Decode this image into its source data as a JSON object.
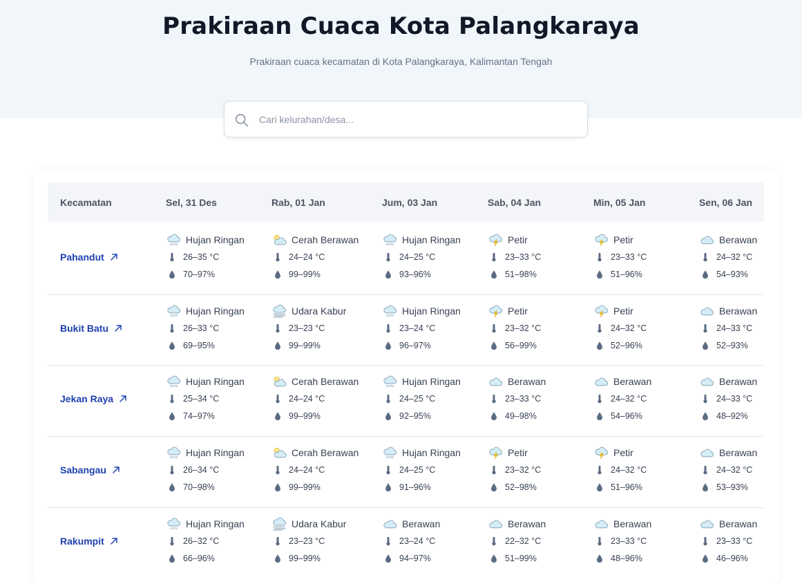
{
  "header": {
    "title": "Prakiraan Cuaca Kota Palangkaraya",
    "subtitle": "Prakiraan cuaca kecamatan di Kota Palangkaraya, Kalimantan Tengah"
  },
  "search": {
    "placeholder": "Cari kelurahan/desa..."
  },
  "table": {
    "col_header": "Kecamatan",
    "days": [
      "Sel, 31 Des",
      "Rab, 01 Jan",
      "Jum, 03 Jan",
      "Sab, 04 Jan",
      "Min, 05 Jan",
      "Sen, 06 Jan"
    ],
    "rows": [
      {
        "name": "Pahandut",
        "cells": [
          {
            "icon": "rain-cloud-icon",
            "cond": "Hujan Ringan",
            "temp": "26–35 °C",
            "hum": "70–97%"
          },
          {
            "icon": "sun-cloud-icon",
            "cond": "Cerah Berawan",
            "temp": "24–24 °C",
            "hum": "99–99%"
          },
          {
            "icon": "rain-cloud-icon",
            "cond": "Hujan Ringan",
            "temp": "24–25 °C",
            "hum": "93–96%"
          },
          {
            "icon": "thunder-cloud-icon",
            "cond": "Petir",
            "temp": "23–33 °C",
            "hum": "51–98%"
          },
          {
            "icon": "thunder-cloud-icon",
            "cond": "Petir",
            "temp": "23–33 °C",
            "hum": "51–96%"
          },
          {
            "icon": "cloud-icon",
            "cond": "Berawan",
            "temp": "24–32 °C",
            "hum": "54–93%"
          }
        ]
      },
      {
        "name": "Bukit Batu",
        "cells": [
          {
            "icon": "rain-cloud-icon",
            "cond": "Hujan Ringan",
            "temp": "26–33 °C",
            "hum": "69–95%"
          },
          {
            "icon": "haze-icon",
            "cond": "Udara Kabur",
            "temp": "23–23 °C",
            "hum": "99–99%"
          },
          {
            "icon": "rain-cloud-icon",
            "cond": "Hujan Ringan",
            "temp": "23–24 °C",
            "hum": "96–97%"
          },
          {
            "icon": "thunder-cloud-icon",
            "cond": "Petir",
            "temp": "23–32 °C",
            "hum": "56–99%"
          },
          {
            "icon": "thunder-cloud-icon",
            "cond": "Petir",
            "temp": "24–32 °C",
            "hum": "52–96%"
          },
          {
            "icon": "cloud-icon",
            "cond": "Berawan",
            "temp": "24–33 °C",
            "hum": "52–93%"
          }
        ]
      },
      {
        "name": "Jekan Raya",
        "cells": [
          {
            "icon": "rain-cloud-icon",
            "cond": "Hujan Ringan",
            "temp": "25–34 °C",
            "hum": "74–97%"
          },
          {
            "icon": "sun-cloud-icon",
            "cond": "Cerah Berawan",
            "temp": "24–24 °C",
            "hum": "99–99%"
          },
          {
            "icon": "rain-cloud-icon",
            "cond": "Hujan Ringan",
            "temp": "24–25 °C",
            "hum": "92–95%"
          },
          {
            "icon": "cloud-icon",
            "cond": "Berawan",
            "temp": "23–33 °C",
            "hum": "49–98%"
          },
          {
            "icon": "cloud-icon",
            "cond": "Berawan",
            "temp": "24–32 °C",
            "hum": "54–96%"
          },
          {
            "icon": "cloud-icon",
            "cond": "Berawan",
            "temp": "24–33 °C",
            "hum": "48–92%"
          }
        ]
      },
      {
        "name": "Sabangau",
        "cells": [
          {
            "icon": "rain-cloud-icon",
            "cond": "Hujan Ringan",
            "temp": "26–34 °C",
            "hum": "70–98%"
          },
          {
            "icon": "sun-cloud-icon",
            "cond": "Cerah Berawan",
            "temp": "24–24 °C",
            "hum": "99–99%"
          },
          {
            "icon": "rain-cloud-icon",
            "cond": "Hujan Ringan",
            "temp": "24–25 °C",
            "hum": "91–96%"
          },
          {
            "icon": "thunder-cloud-icon",
            "cond": "Petir",
            "temp": "23–32 °C",
            "hum": "52–98%"
          },
          {
            "icon": "thunder-cloud-icon",
            "cond": "Petir",
            "temp": "24–32 °C",
            "hum": "51–96%"
          },
          {
            "icon": "cloud-icon",
            "cond": "Berawan",
            "temp": "24–32 °C",
            "hum": "53–93%"
          }
        ]
      },
      {
        "name": "Rakumpit",
        "cells": [
          {
            "icon": "rain-cloud-icon",
            "cond": "Hujan Ringan",
            "temp": "26–32 °C",
            "hum": "66–96%"
          },
          {
            "icon": "haze-icon",
            "cond": "Udara Kabur",
            "temp": "23–23 °C",
            "hum": "99–99%"
          },
          {
            "icon": "cloud-icon",
            "cond": "Berawan",
            "temp": "23–24 °C",
            "hum": "94–97%"
          },
          {
            "icon": "cloud-icon",
            "cond": "Berawan",
            "temp": "22–32 °C",
            "hum": "51–99%"
          },
          {
            "icon": "cloud-icon",
            "cond": "Berawan",
            "temp": "23–33 °C",
            "hum": "48–96%"
          },
          {
            "icon": "cloud-icon",
            "cond": "Berawan",
            "temp": "23–33 °C",
            "hum": "46–96%"
          }
        ]
      }
    ]
  },
  "colors": {
    "hero_bg": "#f1f6fb",
    "link": "#1e40af",
    "icon_slate": "#5b6b82",
    "cloud_fill": "#d4edf6",
    "cloud_stroke": "#8aa4b8"
  }
}
